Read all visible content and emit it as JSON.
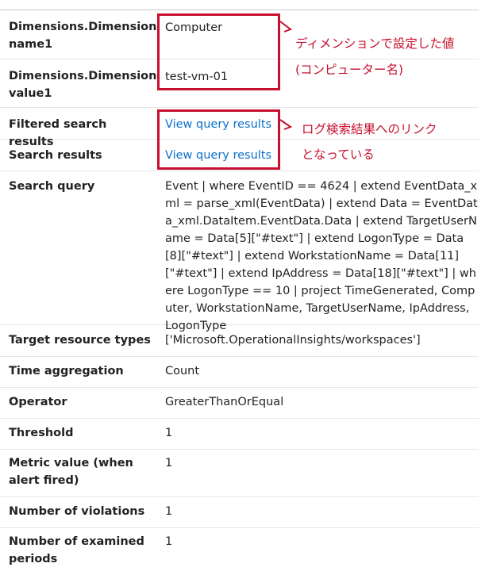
{
  "rows": [
    {
      "label": "Dimensions.Dimension name1",
      "value": "Computer"
    },
    {
      "label": "Dimensions.Dimension value1",
      "value": "test-vm-01"
    },
    {
      "label": "Filtered search results",
      "value": "View query results"
    },
    {
      "label": "Search results",
      "value": "View query results"
    },
    {
      "label": "Search query",
      "value": "Event | where EventID == 4624 | extend EventData_xml = parse_xml(EventData) | extend Data = EventData_xml.DataItem.EventData.Data | extend TargetUserName = Data[5][\"#text\"] | extend LogonType = Data[8][\"#text\"] | extend WorkstationName = Data[11][\"#text\"] | extend IpAddress = Data[18][\"#text\"] | where LogonType == 10 | project TimeGenerated, Computer, WorkstationName, TargetUserName, IpAddress, LogonType"
    },
    {
      "label": "Target resource types",
      "value": "['Microsoft.OperationalInsights/workspaces']"
    },
    {
      "label": "Time aggregation",
      "value": "Count"
    },
    {
      "label": "Operator",
      "value": "GreaterThanOrEqual"
    },
    {
      "label": "Threshold",
      "value": "1"
    },
    {
      "label": "Metric value (when alert fired)",
      "value": "1"
    },
    {
      "label": "Number of violations",
      "value": "1"
    },
    {
      "label": "Number of examined periods",
      "value": "1"
    }
  ],
  "annotations": {
    "dimension_line1": "ディメンションで設定した値",
    "dimension_line2": "(コンピューター名)",
    "link_line1": "ログ検索結果へのリンク",
    "link_line2": "となっている"
  },
  "colors": {
    "annotation": "#c8102e",
    "link": "#0b6fc9",
    "text": "#222222"
  }
}
